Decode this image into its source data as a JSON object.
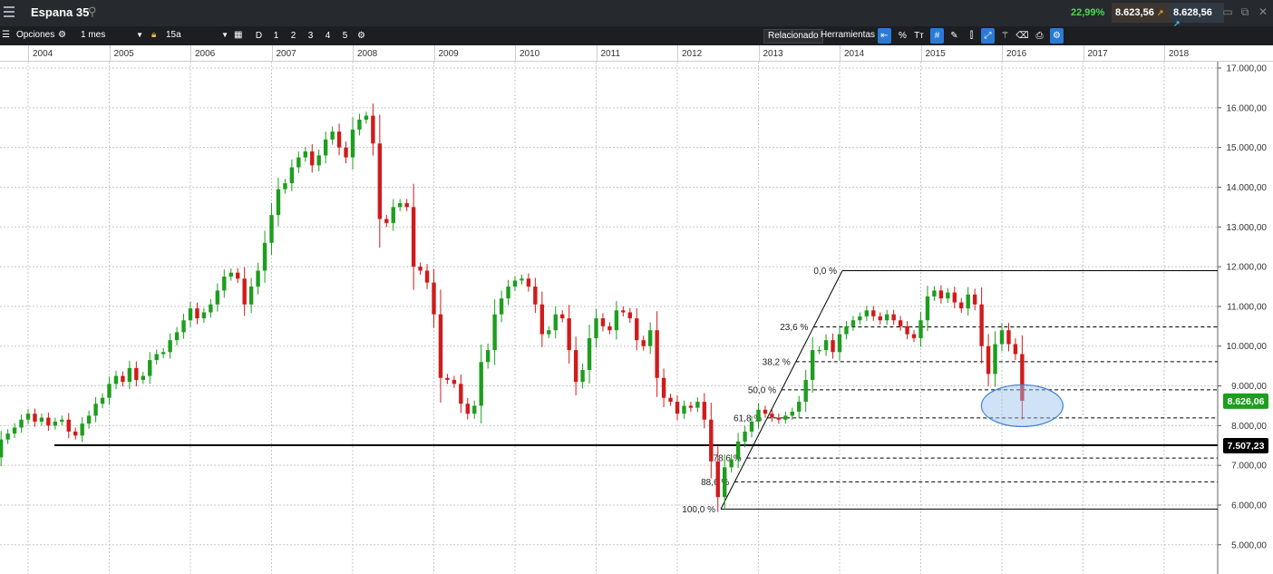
{
  "titlebar": {
    "instrument": "Espana 35",
    "change_pct": "22,99%",
    "sell_price": "8.623,56",
    "buy_price": "8.628,56"
  },
  "toolbar": {
    "options_label": "Opciones",
    "timeframe": "1 mes",
    "range": "15a",
    "period_buttons": [
      "D",
      "1",
      "2",
      "3",
      "4",
      "5"
    ],
    "related_label": "Relacionado",
    "tools_label": "Herramientas"
  },
  "chart_data": {
    "type": "candlestick",
    "x_axis_years": [
      "2004",
      "2005",
      "2006",
      "2007",
      "2008",
      "2009",
      "2010",
      "2011",
      "2012",
      "2013",
      "2014",
      "2015",
      "2016",
      "2017",
      "2018"
    ],
    "y_tick_labels": [
      "17.000,00",
      "16.000,00",
      "15.000,00",
      "14.000,00",
      "13.000,00",
      "12.000,00",
      "11.000,00",
      "10.000,00",
      "9.000,00",
      "8.000,00",
      "7.000,00",
      "6.000,00",
      "5.000,00"
    ],
    "ylim": [
      4700,
      17000
    ],
    "start_month": "2003-08",
    "closes": [
      7200,
      7650,
      7800,
      7950,
      8150,
      8300,
      8100,
      8200,
      8000,
      8100,
      8150,
      7850,
      7750,
      8050,
      8250,
      8550,
      8700,
      9050,
      9250,
      9100,
      9450,
      9150,
      9250,
      9650,
      9800,
      9850,
      10150,
      10350,
      10650,
      10950,
      10700,
      10850,
      11050,
      11400,
      11750,
      11850,
      11700,
      11050,
      11500,
      11900,
      12600,
      13300,
      13950,
      14100,
      14500,
      14750,
      14900,
      14550,
      14800,
      15200,
      15400,
      15000,
      14750,
      15450,
      15700,
      15800,
      15100,
      13200,
      13100,
      13500,
      13600,
      13500,
      12000,
      11900,
      11600,
      10800,
      9200,
      9150,
      9050,
      8550,
      8300,
      8500,
      9600,
      9900,
      10800,
      11200,
      11500,
      11650,
      11700,
      11500,
      11050,
      10300,
      10400,
      10800,
      10700,
      9900,
      9100,
      9400,
      10200,
      10700,
      10500,
      10400,
      10900,
      10850,
      10700,
      10150,
      10000,
      10400,
      9200,
      8700,
      8600,
      8300,
      8500,
      8450,
      8600,
      8150,
      7100,
      6200,
      6950,
      7150,
      7600,
      7850,
      8100,
      8400,
      8300,
      8200,
      8150,
      8250,
      8350,
      8600,
      9150,
      9900,
      9900,
      10150,
      9850,
      10300,
      10500,
      10650,
      10750,
      10900,
      10750,
      10650,
      10800,
      10650,
      10500,
      10300,
      10200,
      10650,
      11250,
      11400,
      11200,
      11350,
      11100,
      10950,
      11300,
      11050,
      10000,
      9300,
      10050,
      10400,
      10050,
      9800,
      8626
    ],
    "last_price": "8.626,06",
    "support_price": "7.507,23",
    "fibonacci": {
      "high": 11900,
      "low": 5900,
      "levels": [
        "0,0 %",
        "23,6 %",
        "38,2 %",
        "50,0 %",
        "61,8 %",
        "78,6 %",
        "88,6 %",
        "100,0 %"
      ]
    },
    "colors": {
      "up": "#1e9e1e",
      "down": "#d01b1b",
      "last_price_badge": "#1e9e1e"
    }
  }
}
